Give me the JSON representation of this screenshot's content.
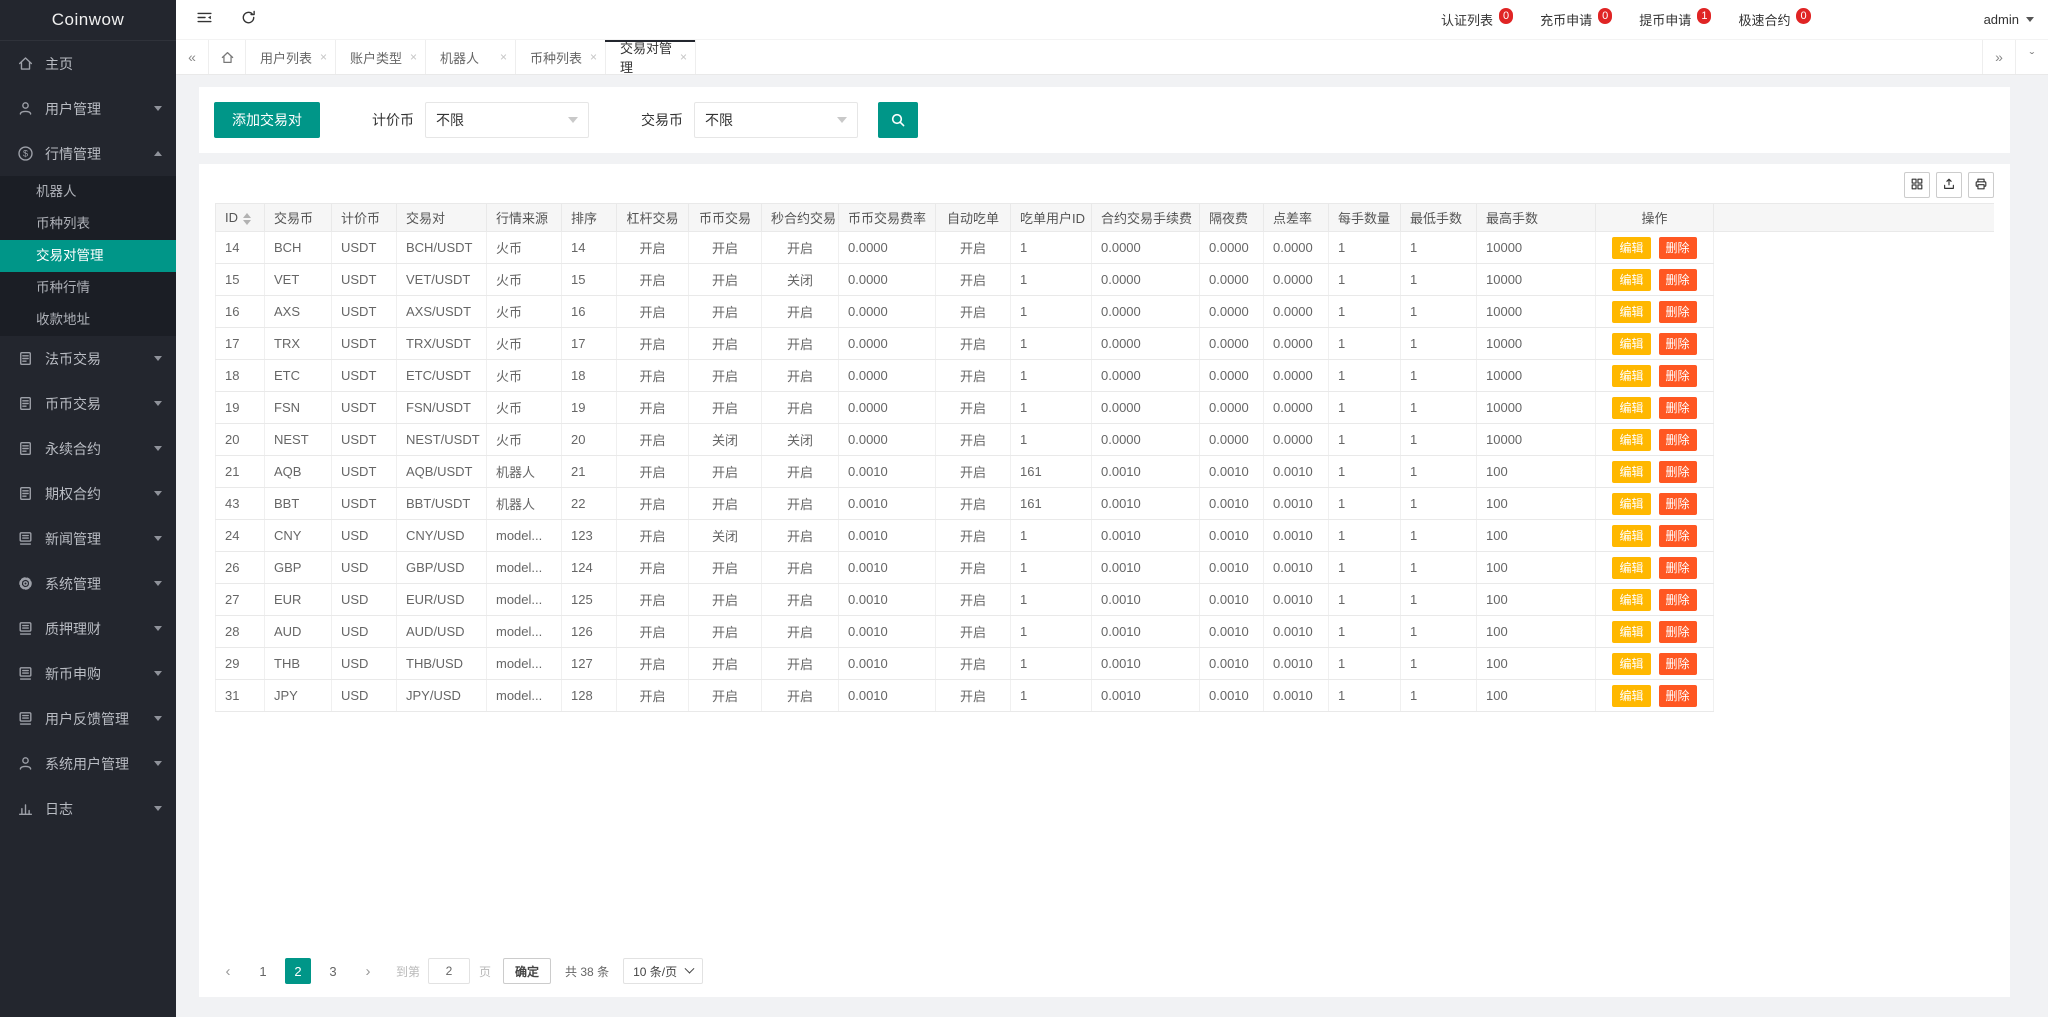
{
  "sidebar": {
    "logo": "Coinwow",
    "menu": [
      {
        "key": "home",
        "label": "主页",
        "icon": "home-icon"
      },
      {
        "key": "user-mgmt",
        "label": "用户管理",
        "icon": "users-icon",
        "arrow": "down"
      },
      {
        "key": "market-mgmt",
        "label": "行情管理",
        "icon": "dollar-icon",
        "arrow": "up",
        "children": [
          {
            "key": "robot",
            "label": "机器人"
          },
          {
            "key": "coin-list",
            "label": "币种列表"
          },
          {
            "key": "pair-mgmt",
            "label": "交易对管理",
            "active": true
          },
          {
            "key": "coin-market",
            "label": "币种行情"
          },
          {
            "key": "payment-address",
            "label": "收款地址"
          }
        ]
      },
      {
        "key": "fiat-trade",
        "label": "法币交易",
        "icon": "doc-icon",
        "arrow": "down"
      },
      {
        "key": "coin-trade",
        "label": "币币交易",
        "icon": "doc-icon",
        "arrow": "down"
      },
      {
        "key": "perpetual-contract",
        "label": "永续合约",
        "icon": "doc-icon",
        "arrow": "down"
      },
      {
        "key": "options-contract",
        "label": "期权合约",
        "icon": "doc-icon",
        "arrow": "down"
      },
      {
        "key": "news-mgmt",
        "label": "新闻管理",
        "icon": "layers-icon",
        "arrow": "down"
      },
      {
        "key": "system-mgmt",
        "label": "系统管理",
        "icon": "gear-icon",
        "arrow": "down"
      },
      {
        "key": "pledge-finance",
        "label": "质押理财",
        "icon": "layers-icon",
        "arrow": "down"
      },
      {
        "key": "new-coin-subscribe",
        "label": "新币申购",
        "icon": "layers-icon",
        "arrow": "down"
      },
      {
        "key": "feedback-mgmt",
        "label": "用户反馈管理",
        "icon": "layers-icon",
        "arrow": "down"
      },
      {
        "key": "system-user-mgmt",
        "label": "系统用户管理",
        "icon": "users-icon",
        "arrow": "down"
      },
      {
        "key": "logs",
        "label": "日志",
        "icon": "chart-icon",
        "arrow": "down"
      }
    ]
  },
  "topbar": {
    "notices": [
      {
        "key": "auth-list",
        "label": "认证列表",
        "count": "0"
      },
      {
        "key": "deposit-request",
        "label": "充币申请",
        "count": "0"
      },
      {
        "key": "withdraw-request",
        "label": "提币申请",
        "count": "1"
      },
      {
        "key": "fast-contract",
        "label": "极速合约",
        "count": "0"
      }
    ],
    "user": "admin"
  },
  "tabs": {
    "items": [
      {
        "key": "user-list",
        "label": "用户列表"
      },
      {
        "key": "account-type",
        "label": "账户类型"
      },
      {
        "key": "robot",
        "label": "机器人"
      },
      {
        "key": "coin-list",
        "label": "币种列表"
      },
      {
        "key": "pair-mgmt",
        "label": "交易对管理",
        "active": true
      }
    ]
  },
  "filter": {
    "add_button": "添加交易对",
    "quote_label": "计价币",
    "quote_value": "不限",
    "trade_label": "交易币",
    "trade_value": "不限"
  },
  "table": {
    "columns": [
      "ID",
      "交易币",
      "计价币",
      "交易对",
      "行情来源",
      "排序",
      "杠杆交易",
      "币币交易",
      "秒合约交易",
      "币币交易费率",
      "自动吃单",
      "吃单用户ID",
      "合约交易手续费",
      "隔夜费",
      "点差率",
      "每手数量",
      "最低手数",
      "最高手数",
      "操作"
    ],
    "status_on": "开启",
    "status_off": "关闭",
    "actions": {
      "edit": "编辑",
      "delete": "删除"
    },
    "rows": [
      [
        "14",
        "BCH",
        "USDT",
        "BCH/USDT",
        "火币",
        "14",
        "开启",
        "开启",
        "开启",
        "0.0000",
        "开启",
        "1",
        "0.0000",
        "0.0000",
        "0.0000",
        "1",
        "1",
        "10000"
      ],
      [
        "15",
        "VET",
        "USDT",
        "VET/USDT",
        "火币",
        "15",
        "开启",
        "开启",
        "关闭",
        "0.0000",
        "开启",
        "1",
        "0.0000",
        "0.0000",
        "0.0000",
        "1",
        "1",
        "10000"
      ],
      [
        "16",
        "AXS",
        "USDT",
        "AXS/USDT",
        "火币",
        "16",
        "开启",
        "开启",
        "开启",
        "0.0000",
        "开启",
        "1",
        "0.0000",
        "0.0000",
        "0.0000",
        "1",
        "1",
        "10000"
      ],
      [
        "17",
        "TRX",
        "USDT",
        "TRX/USDT",
        "火币",
        "17",
        "开启",
        "开启",
        "开启",
        "0.0000",
        "开启",
        "1",
        "0.0000",
        "0.0000",
        "0.0000",
        "1",
        "1",
        "10000"
      ],
      [
        "18",
        "ETC",
        "USDT",
        "ETC/USDT",
        "火币",
        "18",
        "开启",
        "开启",
        "开启",
        "0.0000",
        "开启",
        "1",
        "0.0000",
        "0.0000",
        "0.0000",
        "1",
        "1",
        "10000"
      ],
      [
        "19",
        "FSN",
        "USDT",
        "FSN/USDT",
        "火币",
        "19",
        "开启",
        "开启",
        "开启",
        "0.0000",
        "开启",
        "1",
        "0.0000",
        "0.0000",
        "0.0000",
        "1",
        "1",
        "10000"
      ],
      [
        "20",
        "NEST",
        "USDT",
        "NEST/USDT",
        "火币",
        "20",
        "开启",
        "关闭",
        "关闭",
        "0.0000",
        "开启",
        "1",
        "0.0000",
        "0.0000",
        "0.0000",
        "1",
        "1",
        "10000"
      ],
      [
        "21",
        "AQB",
        "USDT",
        "AQB/USDT",
        "机器人",
        "21",
        "开启",
        "开启",
        "开启",
        "0.0010",
        "开启",
        "161",
        "0.0010",
        "0.0010",
        "0.0010",
        "1",
        "1",
        "100"
      ],
      [
        "43",
        "BBT",
        "USDT",
        "BBT/USDT",
        "机器人",
        "22",
        "开启",
        "开启",
        "开启",
        "0.0010",
        "开启",
        "161",
        "0.0010",
        "0.0010",
        "0.0010",
        "1",
        "1",
        "100"
      ],
      [
        "24",
        "CNY",
        "USD",
        "CNY/USD",
        "model...",
        "123",
        "开启",
        "关闭",
        "开启",
        "0.0010",
        "开启",
        "1",
        "0.0010",
        "0.0010",
        "0.0010",
        "1",
        "1",
        "100"
      ],
      [
        "26",
        "GBP",
        "USD",
        "GBP/USD",
        "model...",
        "124",
        "开启",
        "开启",
        "开启",
        "0.0010",
        "开启",
        "1",
        "0.0010",
        "0.0010",
        "0.0010",
        "1",
        "1",
        "100"
      ],
      [
        "27",
        "EUR",
        "USD",
        "EUR/USD",
        "model...",
        "125",
        "开启",
        "开启",
        "开启",
        "0.0010",
        "开启",
        "1",
        "0.0010",
        "0.0010",
        "0.0010",
        "1",
        "1",
        "100"
      ],
      [
        "28",
        "AUD",
        "USD",
        "AUD/USD",
        "model...",
        "126",
        "开启",
        "开启",
        "开启",
        "0.0010",
        "开启",
        "1",
        "0.0010",
        "0.0010",
        "0.0010",
        "1",
        "1",
        "100"
      ],
      [
        "29",
        "THB",
        "USD",
        "THB/USD",
        "model...",
        "127",
        "开启",
        "开启",
        "开启",
        "0.0010",
        "开启",
        "1",
        "0.0010",
        "0.0010",
        "0.0010",
        "1",
        "1",
        "100"
      ],
      [
        "31",
        "JPY",
        "USD",
        "JPY/USD",
        "model...",
        "128",
        "开启",
        "开启",
        "开启",
        "0.0010",
        "开启",
        "1",
        "0.0010",
        "0.0010",
        "0.0010",
        "1",
        "1",
        "100"
      ]
    ]
  },
  "pagination": {
    "pages": [
      "1",
      "2",
      "3"
    ],
    "current": "2",
    "goto_label": "到第",
    "goto_value": "2",
    "page_unit": "页",
    "confirm_label": "确定",
    "total_label": "共 38 条",
    "per_page_label": "10 条/页"
  },
  "colors": {
    "accent": "#009688",
    "status_on": "#5FB878",
    "status_off": "#FF5722",
    "edit_button": "#FFB800",
    "delete_button": "#FF5722",
    "badge": "#e02424",
    "sidebar_bg": "#23262e"
  }
}
